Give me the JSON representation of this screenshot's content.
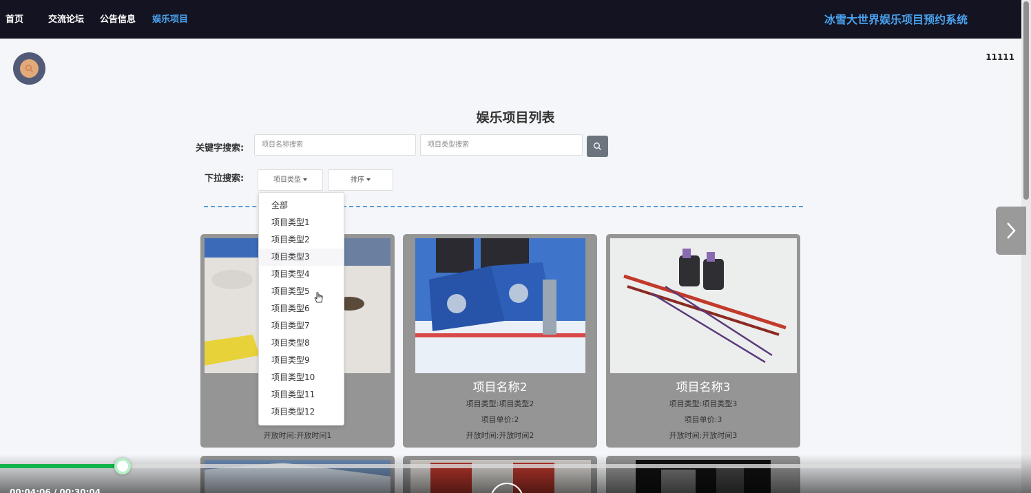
{
  "nav": {
    "items": [
      {
        "label": "首页",
        "active": false
      },
      {
        "label": "交流论坛",
        "active": false
      },
      {
        "label": "公告信息",
        "active": false
      },
      {
        "label": "娱乐项目",
        "active": true
      }
    ],
    "site_title": "冰雪大世界娱乐项目预约系统"
  },
  "user": {
    "name": "11111"
  },
  "page": {
    "title": "娱乐项目列表"
  },
  "search": {
    "keyword_label": "关键字搜索:",
    "name_placeholder": "项目名称搜索",
    "type_placeholder": "项目类型搜索",
    "dropdown_label": "下拉搜索:",
    "type_button": "项目类型",
    "sort_button": "排序"
  },
  "type_options": [
    "全部",
    "项目类型1",
    "项目类型2",
    "项目类型3",
    "项目类型4",
    "项目类型5",
    "项目类型6",
    "项目类型7",
    "项目类型8",
    "项目类型9",
    "项目类型10",
    "项目类型11",
    "项目类型12"
  ],
  "cards": [
    {
      "name": "",
      "type": "",
      "price": "",
      "time": "开放时间:开放时间1"
    },
    {
      "name": "项目名称2",
      "type": "项目类型:项目类型2",
      "price": "项目单价:2",
      "time": "开放时间:开放时间2"
    },
    {
      "name": "项目名称3",
      "type": "项目类型:项目类型3",
      "price": "项目单价:3",
      "time": "开放时间:开放时间3"
    }
  ],
  "video": {
    "time": "00:04:06 / 00:30:04",
    "progress_fraction": 0.12
  },
  "colors": {
    "nav_bg": "#141321",
    "accent": "#4aa3f0",
    "card_bg": "#959595",
    "progress": "#12b34b"
  }
}
